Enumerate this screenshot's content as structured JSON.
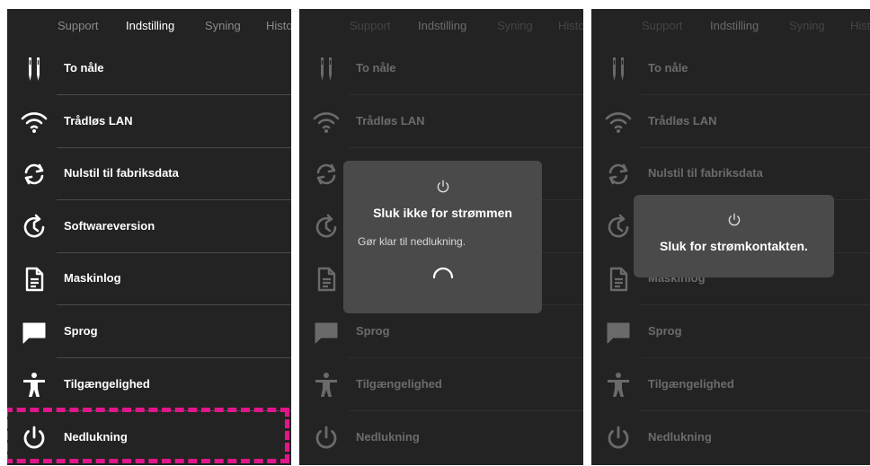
{
  "tabs": [
    "Support",
    "Indstilling",
    "Syning",
    "Histo"
  ],
  "active_tab": "Indstilling",
  "menu": [
    {
      "label": "To nåle",
      "icon": "twin-needle-icon"
    },
    {
      "label": "Trådløs LAN",
      "icon": "wifi-icon"
    },
    {
      "label": "Nulstil til fabriksdata",
      "icon": "reset-icon"
    },
    {
      "label": "Softwareversion",
      "icon": "clock-refresh-icon"
    },
    {
      "label": "Maskinlog",
      "icon": "document-icon"
    },
    {
      "label": "Sprog",
      "icon": "speech-bubble-icon"
    },
    {
      "label": "Tilgængelighed",
      "icon": "accessibility-icon"
    },
    {
      "label": "Nedlukning",
      "icon": "power-icon"
    }
  ],
  "dialog1": {
    "title": "Sluk ikke for strømmen",
    "message": "Gør klar til nedlukning."
  },
  "dialog2": {
    "title": "Sluk for strømkontakten."
  },
  "colors": {
    "background": "#232323",
    "dialog": "#4a4a4a",
    "highlight": "#e0168a",
    "text": "#ffffff"
  }
}
